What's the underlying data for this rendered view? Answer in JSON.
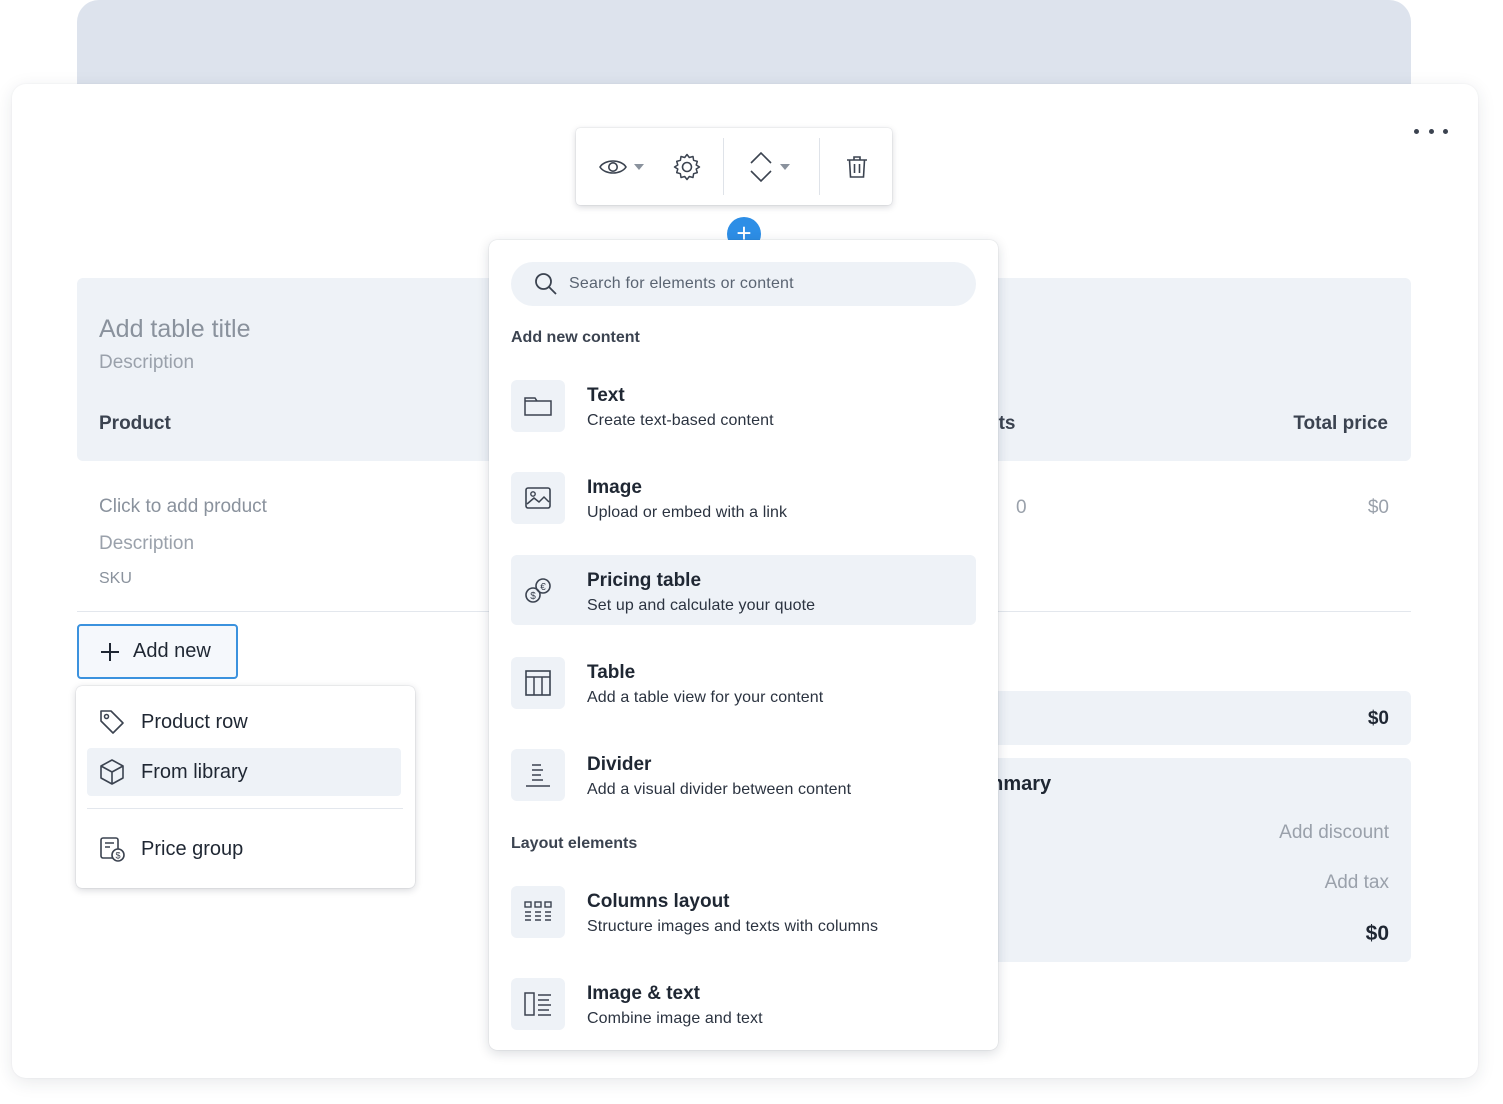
{
  "toolbar": {
    "visibility_icon": "eye-icon",
    "settings_icon": "gear-icon",
    "move_icon": "up-down-chevron-icon",
    "delete_icon": "trash-icon"
  },
  "table": {
    "title": "Add table title",
    "description": "Description",
    "col_product": "Product",
    "col_units": "Units",
    "col_total": "Total price",
    "row": {
      "product_placeholder": "Click to add product",
      "description": "Description",
      "sku": "SKU",
      "units": "0",
      "total": "$0"
    },
    "subtotal": "$0",
    "summary_title": "Summary",
    "add_discount": "Add discount",
    "add_tax": "Add tax",
    "summary_total": "$0"
  },
  "add_new": {
    "label": "Add new",
    "menu": [
      {
        "label": "Product row",
        "icon": "tag-icon"
      },
      {
        "label": "From library",
        "icon": "box-icon"
      },
      {
        "label": "Price group",
        "icon": "price-group-icon"
      }
    ]
  },
  "panel": {
    "search_placeholder": "Search for elements or content",
    "section_content": "Add new content",
    "section_layout": "Layout elements",
    "items": [
      {
        "title": "Text",
        "desc": "Create text-based content",
        "icon": "text-block-icon"
      },
      {
        "title": "Image",
        "desc": "Upload or embed with a link",
        "icon": "image-icon"
      },
      {
        "title": "Pricing table",
        "desc": "Set up and calculate your quote",
        "icon": "coins-icon"
      },
      {
        "title": "Table",
        "desc": "Add a table view for your content",
        "icon": "table-icon"
      },
      {
        "title": "Divider",
        "desc": "Add a visual divider between content",
        "icon": "divider-icon"
      },
      {
        "title": "Columns layout",
        "desc": "Structure images and texts with columns",
        "icon": "columns-icon"
      },
      {
        "title": "Image & text",
        "desc": "Combine image and text",
        "icon": "image-text-icon"
      }
    ]
  },
  "colors": {
    "accent": "#2d8ee6",
    "panel_bg": "#eef2f7",
    "top_band": "#dde3ed"
  }
}
